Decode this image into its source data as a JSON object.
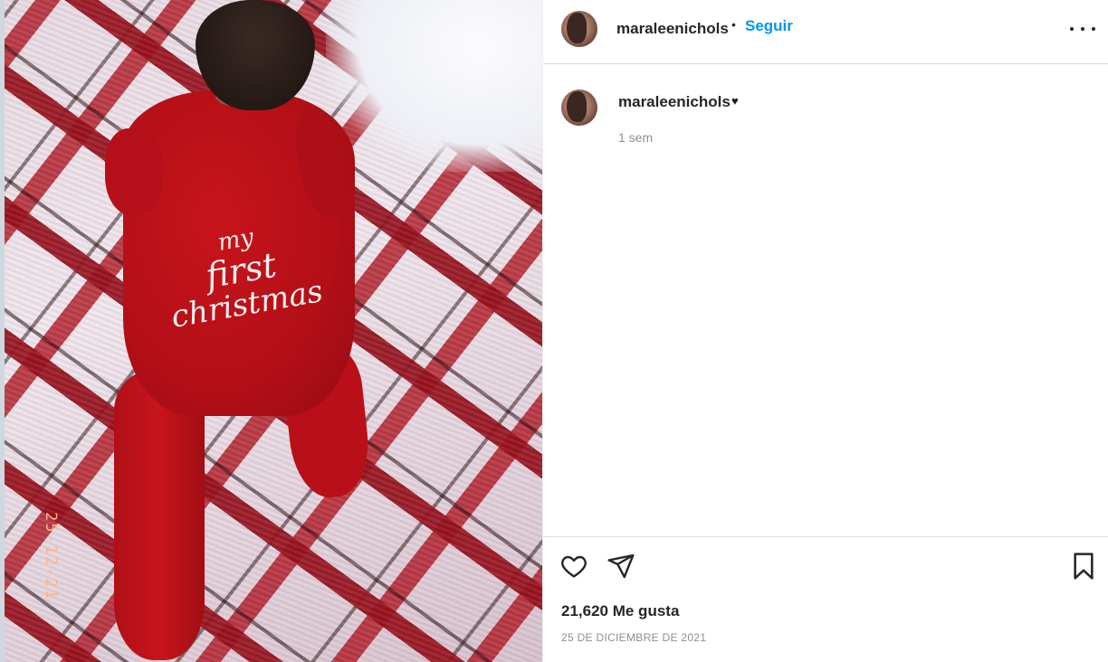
{
  "post": {
    "image_alt": "Baby in red onesie on plaid blanket",
    "onesie_text": {
      "line1": "my",
      "line2": "first",
      "line3": "christmas"
    },
    "photo_stamp": "25-12-21"
  },
  "header": {
    "username": "maraleenichols",
    "separator": "•",
    "follow_label": "Seguir"
  },
  "caption": {
    "username": "maraleenichols",
    "text": "♥",
    "time": "1 sem"
  },
  "actions": {
    "like_icon": "heart-outline-icon",
    "share_icon": "paper-plane-icon",
    "save_icon": "bookmark-icon"
  },
  "stats": {
    "likes": "21,620 Me gusta",
    "date": "25 DE DICIEMBRE DE 2021"
  },
  "colors": {
    "accent": "#0095f6",
    "text": "#262626",
    "muted": "#8e8e8e",
    "onesie": "#c8141b"
  }
}
